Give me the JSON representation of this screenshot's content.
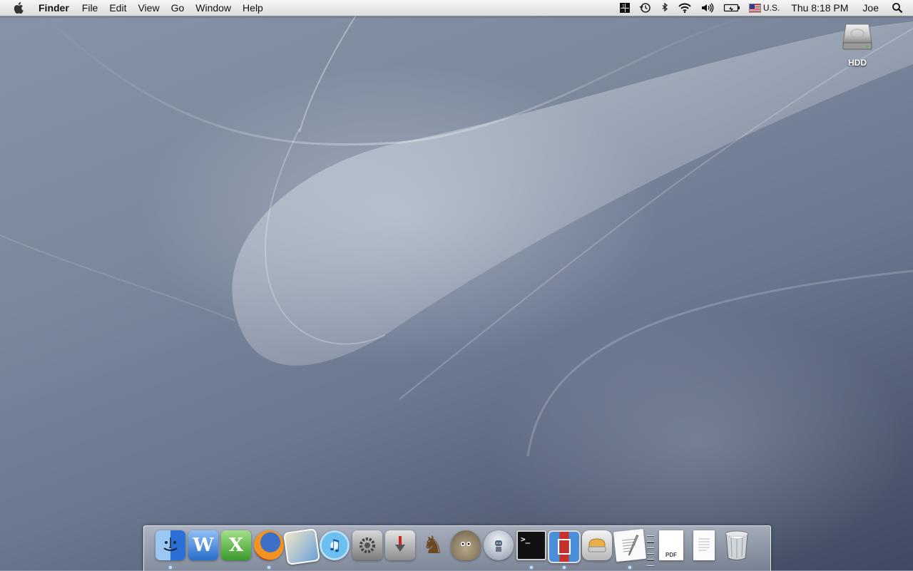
{
  "menubar": {
    "app_name": "Finder",
    "items": [
      "File",
      "Edit",
      "View",
      "Go",
      "Window",
      "Help"
    ],
    "input_source": "U.S.",
    "clock": "Thu 8:18 PM",
    "user": "Joe",
    "status_icons": [
      "spaces-icon",
      "time-machine-icon",
      "bluetooth-icon",
      "wifi-icon",
      "volume-icon",
      "battery-icon"
    ]
  },
  "desktop": {
    "icons": [
      {
        "label": "HDD",
        "icon": "hard-drive-icon"
      }
    ]
  },
  "dock": {
    "apps": [
      {
        "icon": "finder-icon",
        "running": true,
        "color": "#3a86e0"
      },
      {
        "icon": "word-icon",
        "running": false,
        "color": "#3f7fd6"
      },
      {
        "icon": "excel-icon",
        "running": false,
        "color": "#4fa63b"
      },
      {
        "icon": "firefox-icon",
        "running": true,
        "color": "#e86a1a"
      },
      {
        "icon": "iphoto-icon",
        "running": false,
        "color": "#6a8fb8"
      },
      {
        "icon": "itunes-icon",
        "running": false,
        "color": "#5ab0e8"
      },
      {
        "icon": "system-preferences-icon",
        "running": false,
        "color": "#8c8c8c"
      },
      {
        "icon": "transmit-icon",
        "running": false,
        "color": "#9a9a9a"
      },
      {
        "icon": "chess-icon",
        "running": false,
        "color": "#8a6a3a"
      },
      {
        "icon": "gimp-icon",
        "running": false,
        "color": "#8a8070"
      },
      {
        "icon": "automator-icon",
        "running": false,
        "color": "#c0c6d0"
      },
      {
        "icon": "terminal-icon",
        "running": true,
        "color": "#1a1a1a"
      },
      {
        "icon": "photo-booth-icon",
        "running": true,
        "color": "#c23a2a"
      },
      {
        "icon": "toast-icon",
        "running": false,
        "color": "#d8b060"
      },
      {
        "icon": "textedit-icon",
        "running": true,
        "color": "#e8e8e8"
      }
    ],
    "docs": [
      {
        "icon": "pdf-document-icon",
        "label": "PDF"
      },
      {
        "icon": "text-document-icon"
      },
      {
        "icon": "trash-icon"
      }
    ]
  }
}
